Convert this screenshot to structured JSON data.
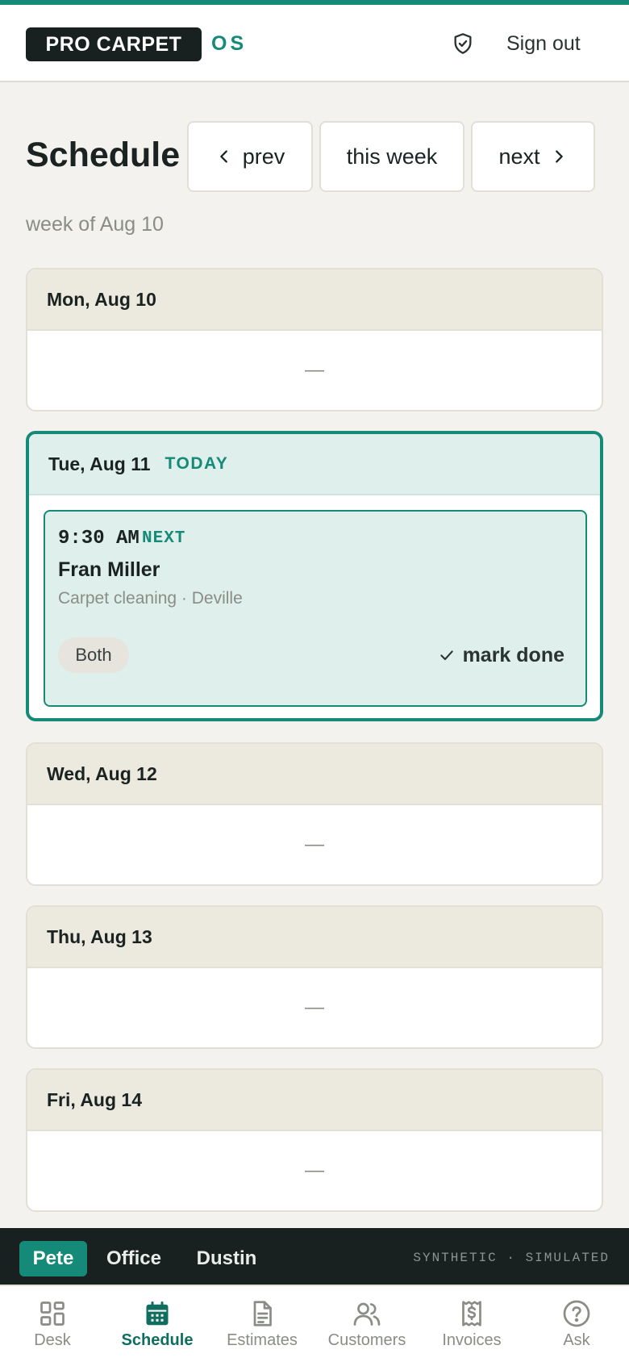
{
  "header": {
    "brand": "PRO CARPET",
    "brand_suffix": "OS",
    "sign_out": "Sign out"
  },
  "schedule": {
    "title": "Schedule",
    "prev": "prev",
    "this_week": "this week",
    "next": "next",
    "week_of": "week of Aug 10"
  },
  "days": [
    {
      "label": "Mon, Aug 10",
      "empty": "—"
    },
    {
      "label": "Tue, Aug 11",
      "badge": "TODAY"
    },
    {
      "label": "Wed, Aug 12",
      "empty": "—"
    },
    {
      "label": "Thu, Aug 13",
      "empty": "—"
    },
    {
      "label": "Fri, Aug 14",
      "empty": "—"
    }
  ],
  "appointment": {
    "time": "9:30 AM",
    "tag": "NEXT",
    "customer": "Fran Miller",
    "detail": "Carpet cleaning · Deville",
    "crew": "Both",
    "action": "mark done"
  },
  "users": {
    "active": "Pete",
    "items": [
      "Pete",
      "Office",
      "Dustin"
    ],
    "note": "SYNTHETIC · SIMULATED"
  },
  "bottom_nav": {
    "active": "Schedule",
    "items": [
      {
        "label": "Desk",
        "icon": "grid-icon"
      },
      {
        "label": "Schedule",
        "icon": "calendar-icon"
      },
      {
        "label": "Estimates",
        "icon": "document-icon"
      },
      {
        "label": "Customers",
        "icon": "users-icon"
      },
      {
        "label": "Invoices",
        "icon": "receipt-dollar-icon"
      },
      {
        "label": "Ask",
        "icon": "help-circle-icon"
      }
    ]
  },
  "colors": {
    "accent": "#168a78",
    "dark": "#18211f",
    "background": "#f3f2ee",
    "day_header": "#ece9df",
    "today_fill": "#dfefeb"
  }
}
